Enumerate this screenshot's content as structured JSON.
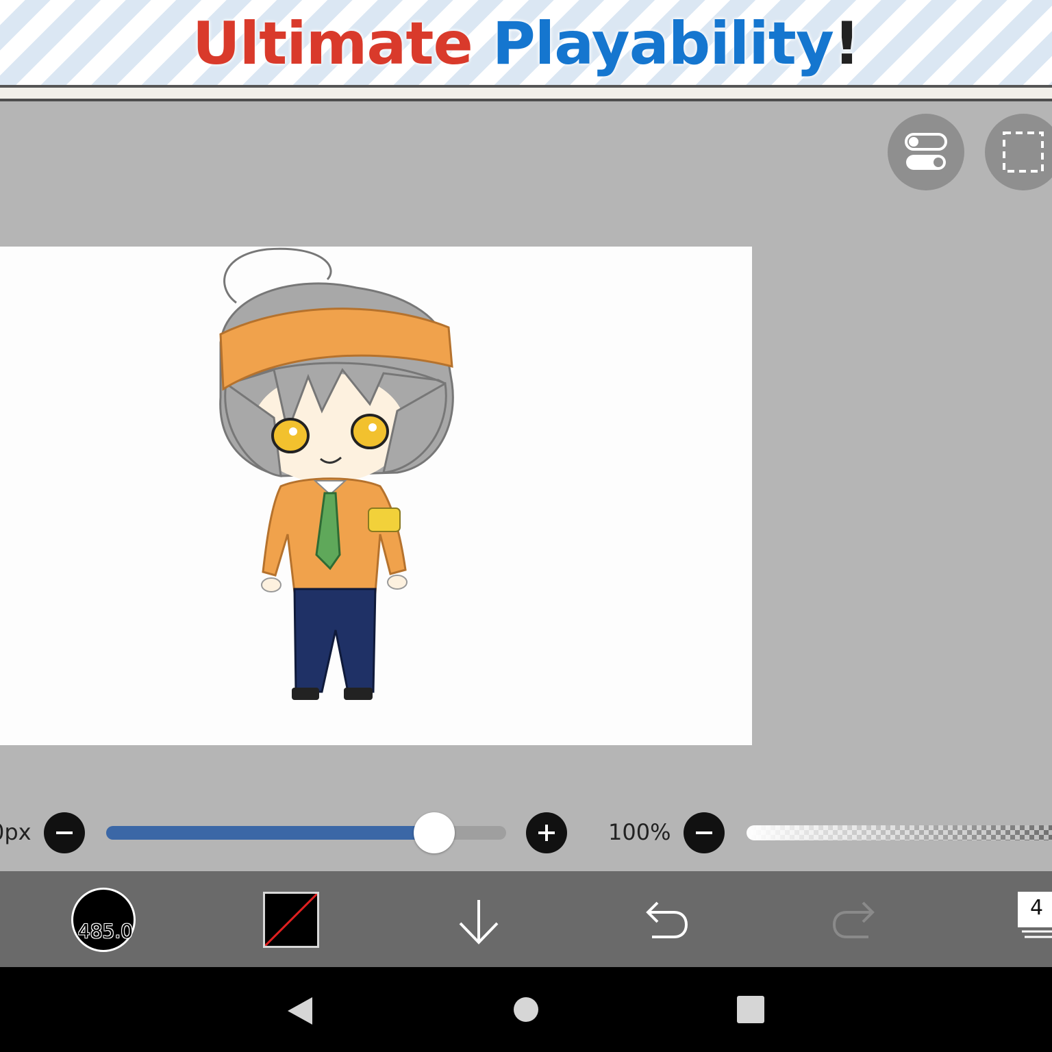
{
  "banner": {
    "word1": "Ultimate",
    "word2": "Playability",
    "bang": "!",
    "colors": {
      "word1": "#d93a2b",
      "word2": "#1576cf"
    }
  },
  "canvas_tools": {
    "toggle_icon": "toggle-icon",
    "selection_icon": "selection-icon"
  },
  "sliders": {
    "size_label": "0px",
    "size_fraction": 0.82,
    "opacity_label": "100%",
    "accent_color": "#3b67a6"
  },
  "toolbar": {
    "brush_size": "485.0",
    "primary_color": "#000000",
    "layer_count": "4",
    "icons": [
      "brush-size-icon",
      "color-swatch-icon",
      "arrow-down-icon",
      "undo-icon",
      "redo-icon",
      "layers-icon"
    ]
  },
  "navigation": {
    "icons": [
      "back-icon",
      "home-icon",
      "recents-icon"
    ]
  }
}
